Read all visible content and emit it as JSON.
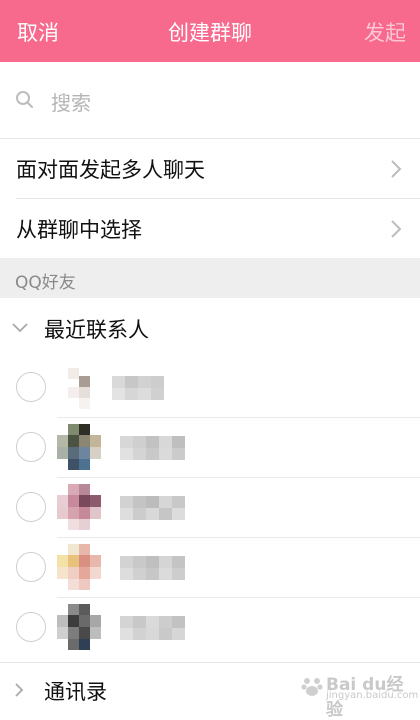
{
  "header": {
    "cancel_label": "取消",
    "title": "创建群聊",
    "send_label": "发起"
  },
  "search": {
    "placeholder": "搜索"
  },
  "options": [
    {
      "label": "面对面发起多人聊天"
    },
    {
      "label": "从群聊中选择"
    }
  ],
  "section": {
    "label": "QQ好友"
  },
  "recent": {
    "label": "最近联系人",
    "contacts": [
      {
        "name": ""
      },
      {
        "name": ""
      },
      {
        "name": ""
      },
      {
        "name": ""
      },
      {
        "name": ""
      }
    ]
  },
  "address_book": {
    "label": "通讯录"
  },
  "watermark": {
    "line1": "Bai du经验",
    "line2": "jingyan.baidu.com"
  },
  "colors": {
    "header_bg": "#f7698d",
    "send_disabled": "#fbc7d5",
    "section_bg": "#eeeeef"
  }
}
